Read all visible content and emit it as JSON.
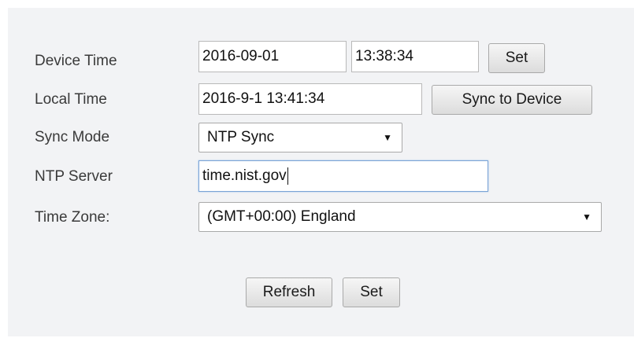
{
  "form": {
    "device_time": {
      "label": "Device Time",
      "date_value": "2016-09-01",
      "time_value": "13:38:34",
      "set_label": "Set"
    },
    "local_time": {
      "label": "Local Time",
      "value": "2016-9-1 13:41:34",
      "sync_label": "Sync to Device"
    },
    "sync_mode": {
      "label": "Sync Mode",
      "selected": "NTP Sync"
    },
    "ntp_server": {
      "label": "NTP Server",
      "value": "time.nist.gov"
    },
    "time_zone": {
      "label": "Time Zone:",
      "selected": "(GMT+00:00) England"
    }
  },
  "actions": {
    "refresh_label": "Refresh",
    "set_label": "Set"
  },
  "icons": {
    "dropdown": "chevron-down-icon"
  }
}
